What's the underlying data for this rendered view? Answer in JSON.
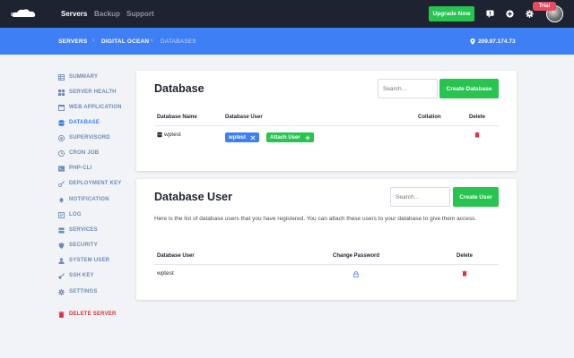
{
  "topnav": {
    "items": [
      {
        "label": "Servers"
      },
      {
        "label": "Backup"
      },
      {
        "label": "Support"
      }
    ],
    "upgrade_label": "Upgrade Now",
    "trial_badge": "Trial",
    "icons": [
      "cloud-logo-icon",
      "message-icon",
      "plus-circle-icon",
      "gear-icon"
    ]
  },
  "breadcrumb": {
    "items": [
      "SERVERS",
      "DIGITAL OCEAN",
      "DATABASES"
    ],
    "ip": "209.97.174.73"
  },
  "sidebar": {
    "items": [
      {
        "label": "SUMMARY",
        "icon": "table-icon"
      },
      {
        "label": "SERVER HEALTH",
        "icon": "grid-icon"
      },
      {
        "label": "WEB APPLICATION",
        "icon": "window-icon"
      },
      {
        "label": "DATABASE",
        "icon": "database-icon"
      },
      {
        "label": "SUPERVISORD",
        "icon": "supervisor-icon"
      },
      {
        "label": "CRON JOB",
        "icon": "clock-icon"
      },
      {
        "label": "PHP-CLI",
        "icon": "terminal-icon"
      },
      {
        "label": "DEPLOYMENT KEY",
        "icon": "key-icon"
      },
      {
        "label": "NOTIFICATION",
        "icon": "bell-icon"
      },
      {
        "label": "LOG",
        "icon": "list-icon"
      },
      {
        "label": "SERVICES",
        "icon": "services-icon"
      },
      {
        "label": "SECURITY",
        "icon": "shield-icon"
      },
      {
        "label": "SYSTEM USER",
        "icon": "user-icon"
      },
      {
        "label": "SSH KEY",
        "icon": "ssh-key-icon"
      },
      {
        "label": "SETTINGS",
        "icon": "settings-icon"
      }
    ],
    "delete_label": "DELETE SERVER",
    "active_color": "#3f7ff5",
    "danger_color": "#e0303f"
  },
  "database_card": {
    "title": "Database",
    "search_placeholder": "Search...",
    "create_label": "Create Database",
    "columns": [
      "Database Name",
      "Database User",
      "Collation",
      "Delete"
    ],
    "rows": [
      {
        "name": "wptest",
        "user_tag": "wptest",
        "attach_label": "Attach User"
      }
    ]
  },
  "user_card": {
    "title": "Database User",
    "search_placeholder": "Search...",
    "create_label": "Create User",
    "description": "Here is the list of database users that you have registered. You can attach these users to your database to give them access.",
    "columns": [
      "Database User",
      "Change Password",
      "Delete"
    ],
    "rows": [
      {
        "user": "wptest"
      }
    ]
  },
  "colors": {
    "topbar": "#1d2330",
    "crumbbar": "#3f7ff5",
    "green": "#27c44f",
    "delete_red": "#e0303f"
  }
}
